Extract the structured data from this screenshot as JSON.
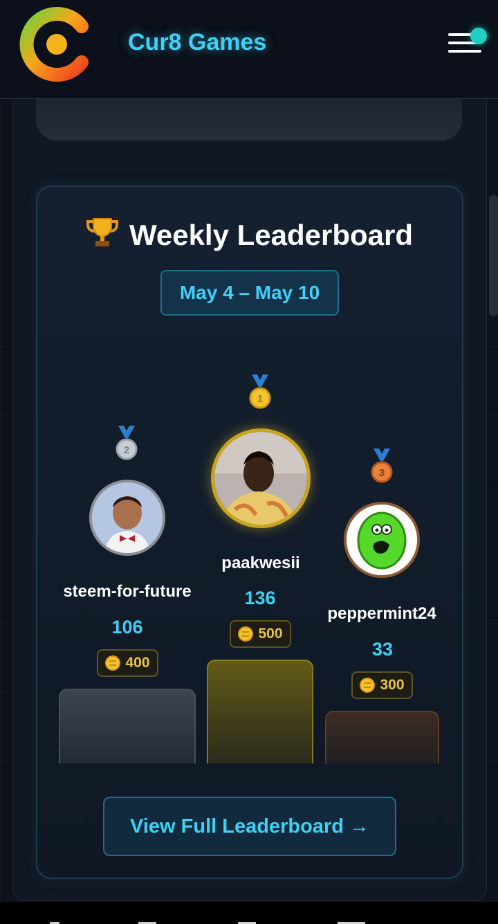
{
  "header": {
    "brand": "Cur8 Games",
    "logo_icon": "cur8-logo-icon",
    "menu_icon": "hamburger-menu-icon"
  },
  "leaderboard": {
    "title": "Weekly Leaderboard",
    "title_icon": "trophy-icon",
    "date_range": "May 4 – May 10",
    "podium": [
      {
        "rank": 2,
        "username": "steem-for-future",
        "score": "106",
        "prize": "400",
        "medal": "silver-medal-icon"
      },
      {
        "rank": 1,
        "username": "paakwesii",
        "score": "136",
        "prize": "500",
        "medal": "gold-medal-icon"
      },
      {
        "rank": 3,
        "username": "peppermint24",
        "score": "33",
        "prize": "300",
        "medal": "bronze-medal-icon"
      }
    ],
    "cta_label": "View Full Leaderboard →"
  },
  "colors": {
    "accent": "#3fd0f5",
    "gold": "#e9c24a",
    "background": "#0c111a",
    "notification_dot": "#21cfc0"
  }
}
